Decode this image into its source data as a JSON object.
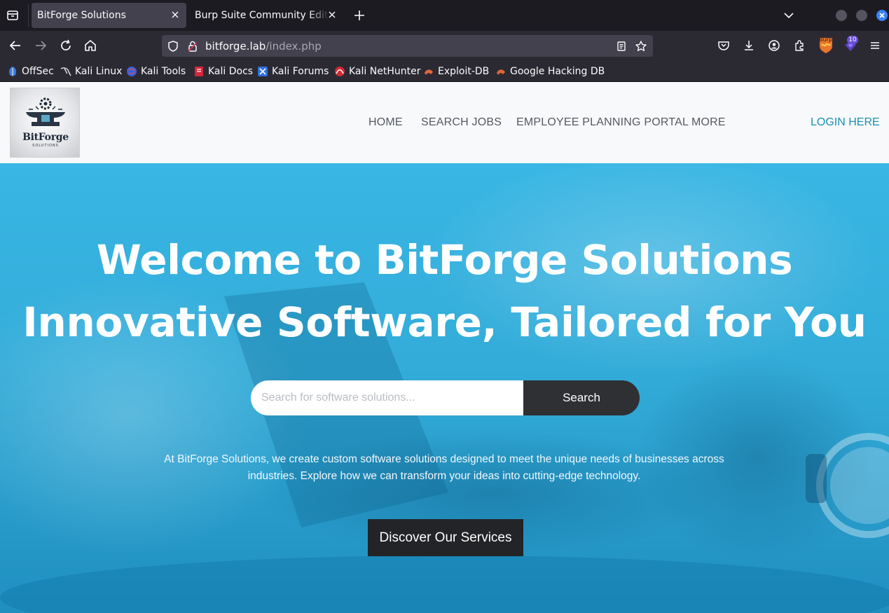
{
  "browser": {
    "tabs": [
      {
        "title": "BitForge Solutions",
        "active": true
      },
      {
        "title": "Burp Suite Community Edition",
        "active": false
      }
    ],
    "url": {
      "host": "bitforge.lab",
      "path": "/index.php"
    },
    "extension_badge": "10",
    "burp_icon_text": "Burp",
    "bookmarks": [
      {
        "label": "OffSec",
        "icon": "offsec-icon"
      },
      {
        "label": "Kali Linux",
        "icon": "kali-dragon-icon"
      },
      {
        "label": "Kali Tools",
        "icon": "kali-tools-icon"
      },
      {
        "label": "Kali Docs",
        "icon": "kali-docs-icon"
      },
      {
        "label": "Kali Forums",
        "icon": "kali-forums-icon"
      },
      {
        "label": "Kali NetHunter",
        "icon": "nethunter-icon"
      },
      {
        "label": "Exploit-DB",
        "icon": "exploitdb-icon"
      },
      {
        "label": "Google Hacking DB",
        "icon": "ghdb-icon"
      }
    ]
  },
  "site": {
    "logo": {
      "word": "BitForge",
      "sub": "SOLUTIONS"
    },
    "menu": [
      "HOME",
      "SEARCH JOBS",
      "EMPLOYEE PLANNING PORTAL",
      "MORE"
    ],
    "login": "LOGIN HERE",
    "hero": {
      "title_line1": "Welcome to BitForge Solutions",
      "title_line2": "Innovative Software, Tailored for You",
      "search_placeholder": "Search for software solutions...",
      "search_button": "Search",
      "description": "At BitForge Solutions, we create custom software solutions designed to meet the unique needs of businesses across industries. Explore how we can transform your ideas into cutting-edge technology.",
      "cta": "Discover Our Services"
    }
  },
  "colors": {
    "hero_blue": "#39b6e4",
    "login_link": "#1a8fb0",
    "dark_button": "#2e3034"
  }
}
